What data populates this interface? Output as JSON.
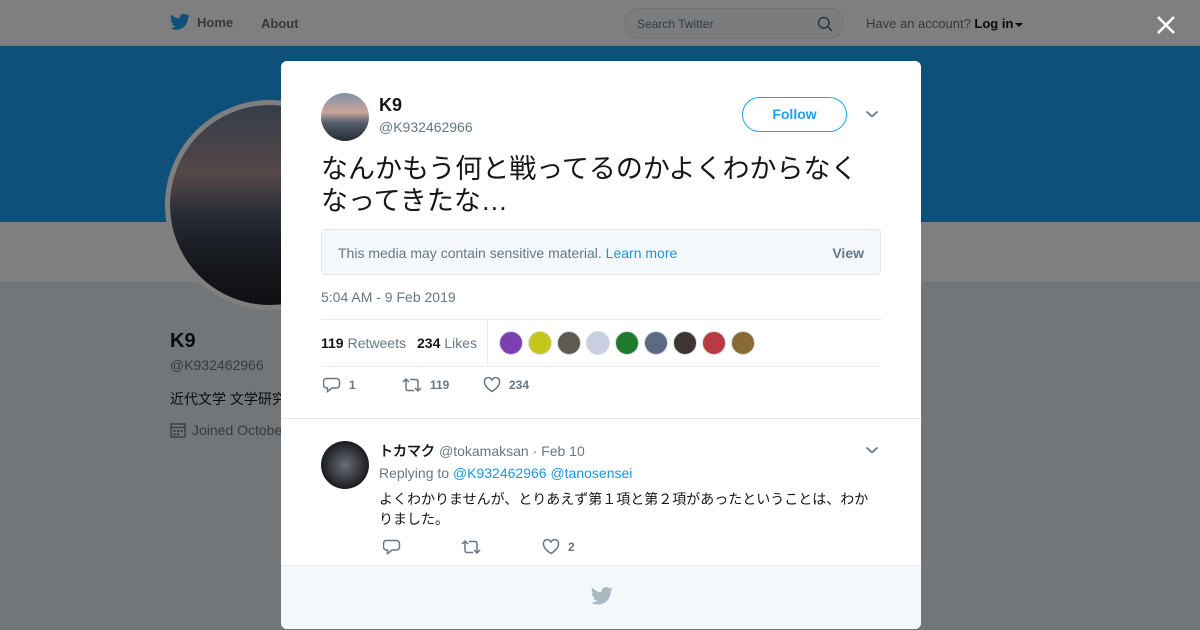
{
  "topbar": {
    "home_label": "Home",
    "about_label": "About",
    "search_placeholder": "Search Twitter",
    "account_prompt": "Have an account?",
    "login_label": "Log in"
  },
  "profile": {
    "name": "K9",
    "handle": "@K932462966",
    "bio": "近代文学 文学研究",
    "joined": "Joined Octobe"
  },
  "tweet": {
    "author_name": "K9",
    "author_handle": "@K932462966",
    "follow_label": "Follow",
    "text": "なんかもう何と戦ってるのかよくわからなくなってきたな…",
    "sensitive_message": "This media may contain sensitive material.",
    "learn_more_label": "Learn more",
    "view_label": "View",
    "timestamp": "5:04 AM - 9 Feb 2019",
    "retweets_count": "119",
    "retweets_label": "Retweets",
    "likes_count": "234",
    "likes_label": "Likes",
    "reply_count": "1",
    "retweet_count": "119",
    "like_count": "234",
    "liker_colors": [
      "#7b3fb0",
      "#c6c51b",
      "#5e5a52",
      "#c9cfe0",
      "#1f7a2e",
      "#5a6c82",
      "#3d3531",
      "#b83a44",
      "#8a6a34"
    ]
  },
  "reply": {
    "author_name": "トカマク",
    "author_handle": "@tokamaksan",
    "date": "· Feb 10",
    "replying_prefix": "Replying to",
    "replying_user1": "@K932462966",
    "replying_user2": "@tanosensei",
    "text": "よくわかりませんが、とりあえず第１項と第２項があったということは、わかりました。",
    "like_count": "2"
  },
  "colors": {
    "brand": "#1da1f2",
    "link": "#1b95e0",
    "muted": "#657786"
  }
}
